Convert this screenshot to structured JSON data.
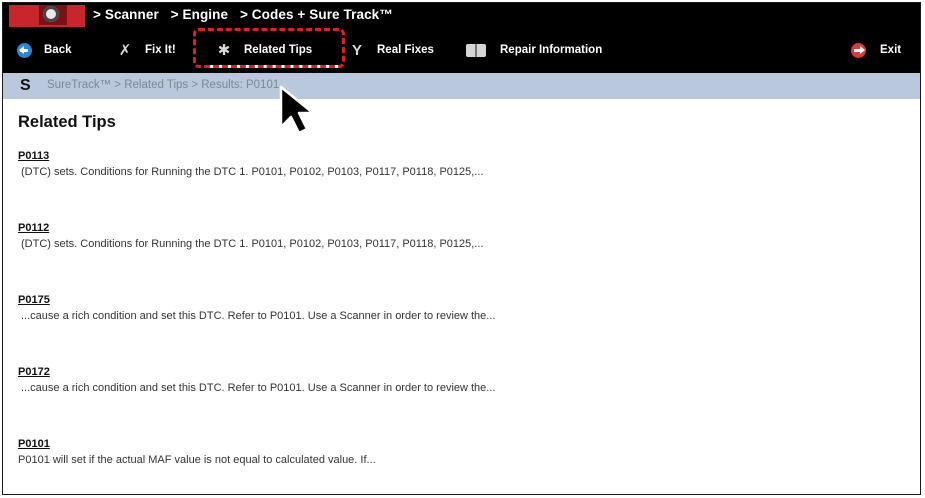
{
  "titlebar": {
    "crumbs": [
      "> Scanner",
      "> Engine",
      "> Codes + Sure Track™"
    ]
  },
  "toolbar": {
    "back_label": "Back",
    "fixit_label": "Fix It!",
    "related_tips_label": "Related Tips",
    "real_fixes_label": "Real Fixes",
    "repair_info_label": "Repair Information",
    "exit_label": "Exit",
    "highlight_color": "#e02020"
  },
  "pathbar": {
    "text": "SureTrack™ > Related Tips > Results: P0101"
  },
  "main": {
    "heading": "Related Tips",
    "tips": [
      {
        "code": "P0113",
        "snippet": "(DTC) sets. Conditions for Running the DTC  1. P0101, P0102, P0103, P0117, P0118, P0125,..."
      },
      {
        "code": "P0112",
        "snippet": "(DTC) sets. Conditions for Running the DTC  1. P0101, P0102, P0103, P0117, P0118, P0125,..."
      },
      {
        "code": "P0175",
        "snippet": "...cause a rich condition and set this DTC. Refer to P0101. Use a Scanner in order to review the..."
      },
      {
        "code": "P0172",
        "snippet": "...cause a rich condition and set this DTC. Refer to P0101. Use a Scanner in order to review the..."
      },
      {
        "code": "P0101",
        "snippet": "P0101 will set if the actual MAF value is not equal to calculated value.  If..."
      }
    ]
  }
}
